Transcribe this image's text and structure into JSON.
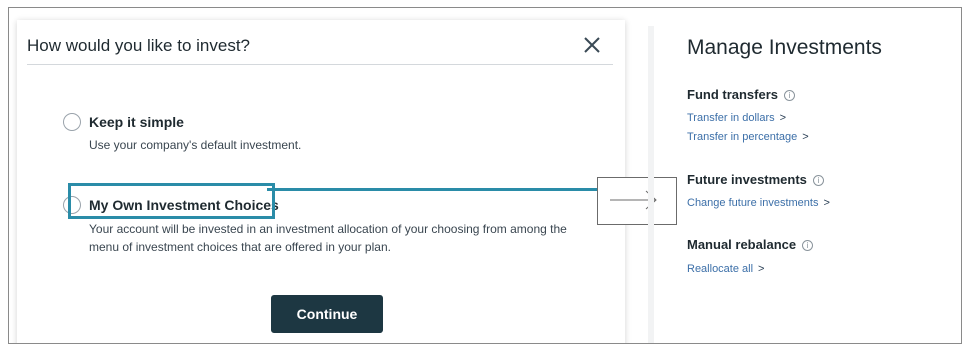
{
  "modal": {
    "title": "How would you like to invest?",
    "close_icon": "close-icon",
    "options": [
      {
        "title": "Keep it simple",
        "description": "Use your company's default investment.",
        "selected": false
      },
      {
        "title": "My Own Investment Choices",
        "description_line1": "Your account will be invested in an investment allocation of your choosing from among the",
        "description_line2": "menu of investment choices that are offered in your plan.",
        "selected": false,
        "highlighted": true
      }
    ],
    "continue_label": "Continue"
  },
  "panel": {
    "title": "Manage Investments",
    "sections": [
      {
        "title": "Fund transfers",
        "links": [
          "Transfer in dollars",
          "Transfer in percentage"
        ]
      },
      {
        "title": "Future investments",
        "links": [
          "Change future investments"
        ]
      },
      {
        "title": "Manual rebalance",
        "links": [
          "Reallocate all"
        ]
      }
    ]
  },
  "colors": {
    "accent_highlight": "#2a8ca8",
    "button_bg": "#1d3742",
    "link": "#3c6fa8",
    "text": "#1f2a30"
  },
  "icons": {
    "close": "close-icon",
    "info": "info-icon",
    "chevron": "chevron-right-icon",
    "arrow": "arrow-right-icon"
  }
}
